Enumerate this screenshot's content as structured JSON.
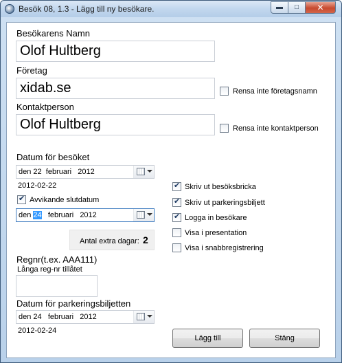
{
  "window": {
    "title": "Besök 08, 1.3 - Lägg till ny besökare."
  },
  "visitor": {
    "name_label": "Besökarens Namn",
    "name_value": "Olof Hultberg",
    "company_label": "Företag",
    "company_value": "xidab.se",
    "contact_label": "Kontaktperson",
    "contact_value": "Olof Hultberg"
  },
  "options": {
    "keep_company_label": "Rensa inte företagsnamn",
    "keep_contact_label": "Rensa inte kontaktperson"
  },
  "visit_date": {
    "label": "Datum för besöket",
    "day": "den 22",
    "month": "februari",
    "year": "2012",
    "iso": "2012-02-22"
  },
  "end_date": {
    "checkbox_label": "Avvikande slutdatum",
    "checked": true,
    "prefix": "den",
    "day": "24",
    "month": "februari",
    "year": "2012"
  },
  "extra_days": {
    "label": "Antal extra dagar:",
    "value": "2"
  },
  "regnr": {
    "label": "Regnr(t.ex. AAA111)",
    "hint": "Långa reg-nr tillåtet",
    "value": ""
  },
  "parking_date": {
    "label": "Datum för parkeringsbiljetten",
    "day": "den 24",
    "month": "februari",
    "year": "2012",
    "iso": "2012-02-24"
  },
  "right_checks": [
    {
      "label": "Skriv ut besöksbricka",
      "checked": true
    },
    {
      "label": "Skriv ut parkeringsbiljett",
      "checked": true
    },
    {
      "label": "Logga in besökare",
      "checked": true
    },
    {
      "label": "Visa i presentation",
      "checked": false
    },
    {
      "label": "Visa i snabbregistrering",
      "checked": false
    }
  ],
  "buttons": {
    "add": "Lägg till",
    "close": "Stäng"
  },
  "colors": {
    "selection": "#3399ff",
    "titlebar": "#c2d7ee",
    "close_button": "#c74a2f"
  },
  "icons": [
    "app-icon",
    "minimize-icon",
    "maximize-icon",
    "close-icon",
    "calendar-icon",
    "chevron-down-icon",
    "checkmark-icon"
  ]
}
